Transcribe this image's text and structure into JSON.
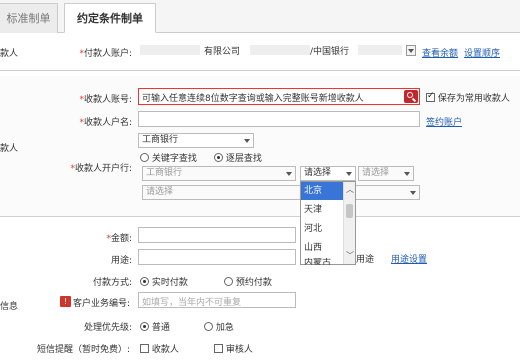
{
  "tabs": {
    "standard": "标准制单",
    "conditional": "约定条件制单"
  },
  "sections": {
    "payer": "款人",
    "payee": "款人",
    "info": "信息"
  },
  "payer": {
    "account_label": "付款人账户:",
    "account_mid": "有限公司",
    "account_bank": "/中国银行",
    "view_balance": "查看余额",
    "set_order": "设置顺序"
  },
  "payee": {
    "account_label": "收款人账号:",
    "account_value": "可输入任意连续8位数字查询或输入完整账号新增收款人",
    "save_common": "保存为常用收款人",
    "name_label": "收款人户名:",
    "sign_account": "签约账户",
    "bank_label": "收款人开户行:",
    "bank_selected": "工商银行",
    "mode_keyword": "关键字查找",
    "mode_level": "逐层查找",
    "level_bank": "工商银行",
    "level_province": "请选择",
    "level_city": "请选择",
    "level_branch": "请选择",
    "province_options": [
      "北京",
      "天津",
      "河北",
      "山西",
      "内蒙古"
    ]
  },
  "info": {
    "amount_label": "金额:",
    "purpose_label": "用途:",
    "purpose_common": "用途",
    "purpose_setting": "用途设置",
    "pay_mode_label": "付款方式:",
    "pay_realtime": "实时付款",
    "pay_scheduled": "预约付款",
    "customer_no_label": "客户业务编号:",
    "customer_no_placeholder": "如填写，当年内不可重复",
    "priority_label": "处理优先级:",
    "priority_normal": "普通",
    "priority_urgent": "加急",
    "sms_label": "短信提醒（暂时免费）:",
    "sms_payee": "收款人",
    "sms_reviewer": "审核人"
  },
  "colors": {
    "required": "#e33333",
    "link": "#1e5cb3",
    "highlight": "#3875d7",
    "error_border": "#e33333"
  }
}
